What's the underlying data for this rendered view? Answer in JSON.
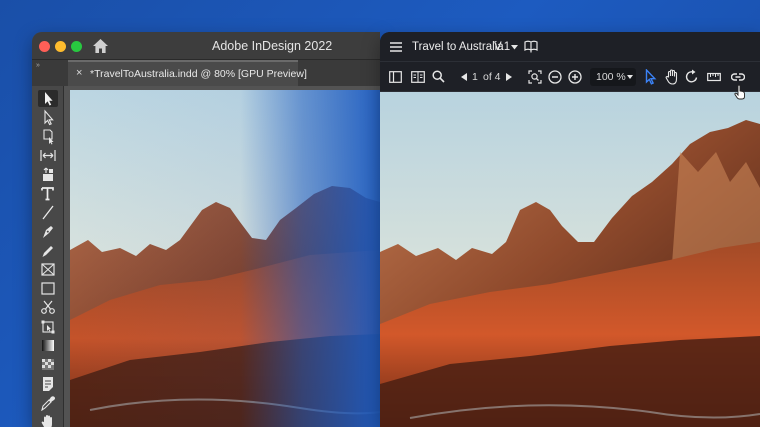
{
  "indesign": {
    "app_title": "Adobe InDesign 2022",
    "tab_title": "*TravelToAustralia.indd @ 80% [GPU Preview]",
    "tab_close": "×",
    "panel_collapse": "»",
    "tools": [
      {
        "name": "selection-tool-icon",
        "active": true
      },
      {
        "name": "direct-selection-tool-icon"
      },
      {
        "name": "page-tool-icon"
      },
      {
        "name": "gap-tool-icon"
      },
      {
        "name": "content-collector-icon"
      },
      {
        "name": "type-tool-icon"
      },
      {
        "name": "line-tool-icon"
      },
      {
        "name": "pen-tool-icon"
      },
      {
        "name": "pencil-tool-icon"
      },
      {
        "name": "rectangle-frame-tool-icon"
      },
      {
        "name": "rectangle-tool-icon"
      },
      {
        "name": "scissors-tool-icon"
      },
      {
        "name": "free-transform-tool-icon"
      },
      {
        "name": "gradient-swatch-tool-icon"
      },
      {
        "name": "gradient-feather-tool-icon"
      },
      {
        "name": "note-tool-icon"
      },
      {
        "name": "eyedropper-tool-icon"
      },
      {
        "name": "hand-tool-icon"
      }
    ]
  },
  "reviewer": {
    "title": "Travel to Australia",
    "version": "V.1",
    "page_current": "1",
    "page_of": "of 4",
    "zoom": "100 %"
  },
  "colors": {
    "background": "#1d5bc0",
    "active_tool": "#3b82f6"
  }
}
